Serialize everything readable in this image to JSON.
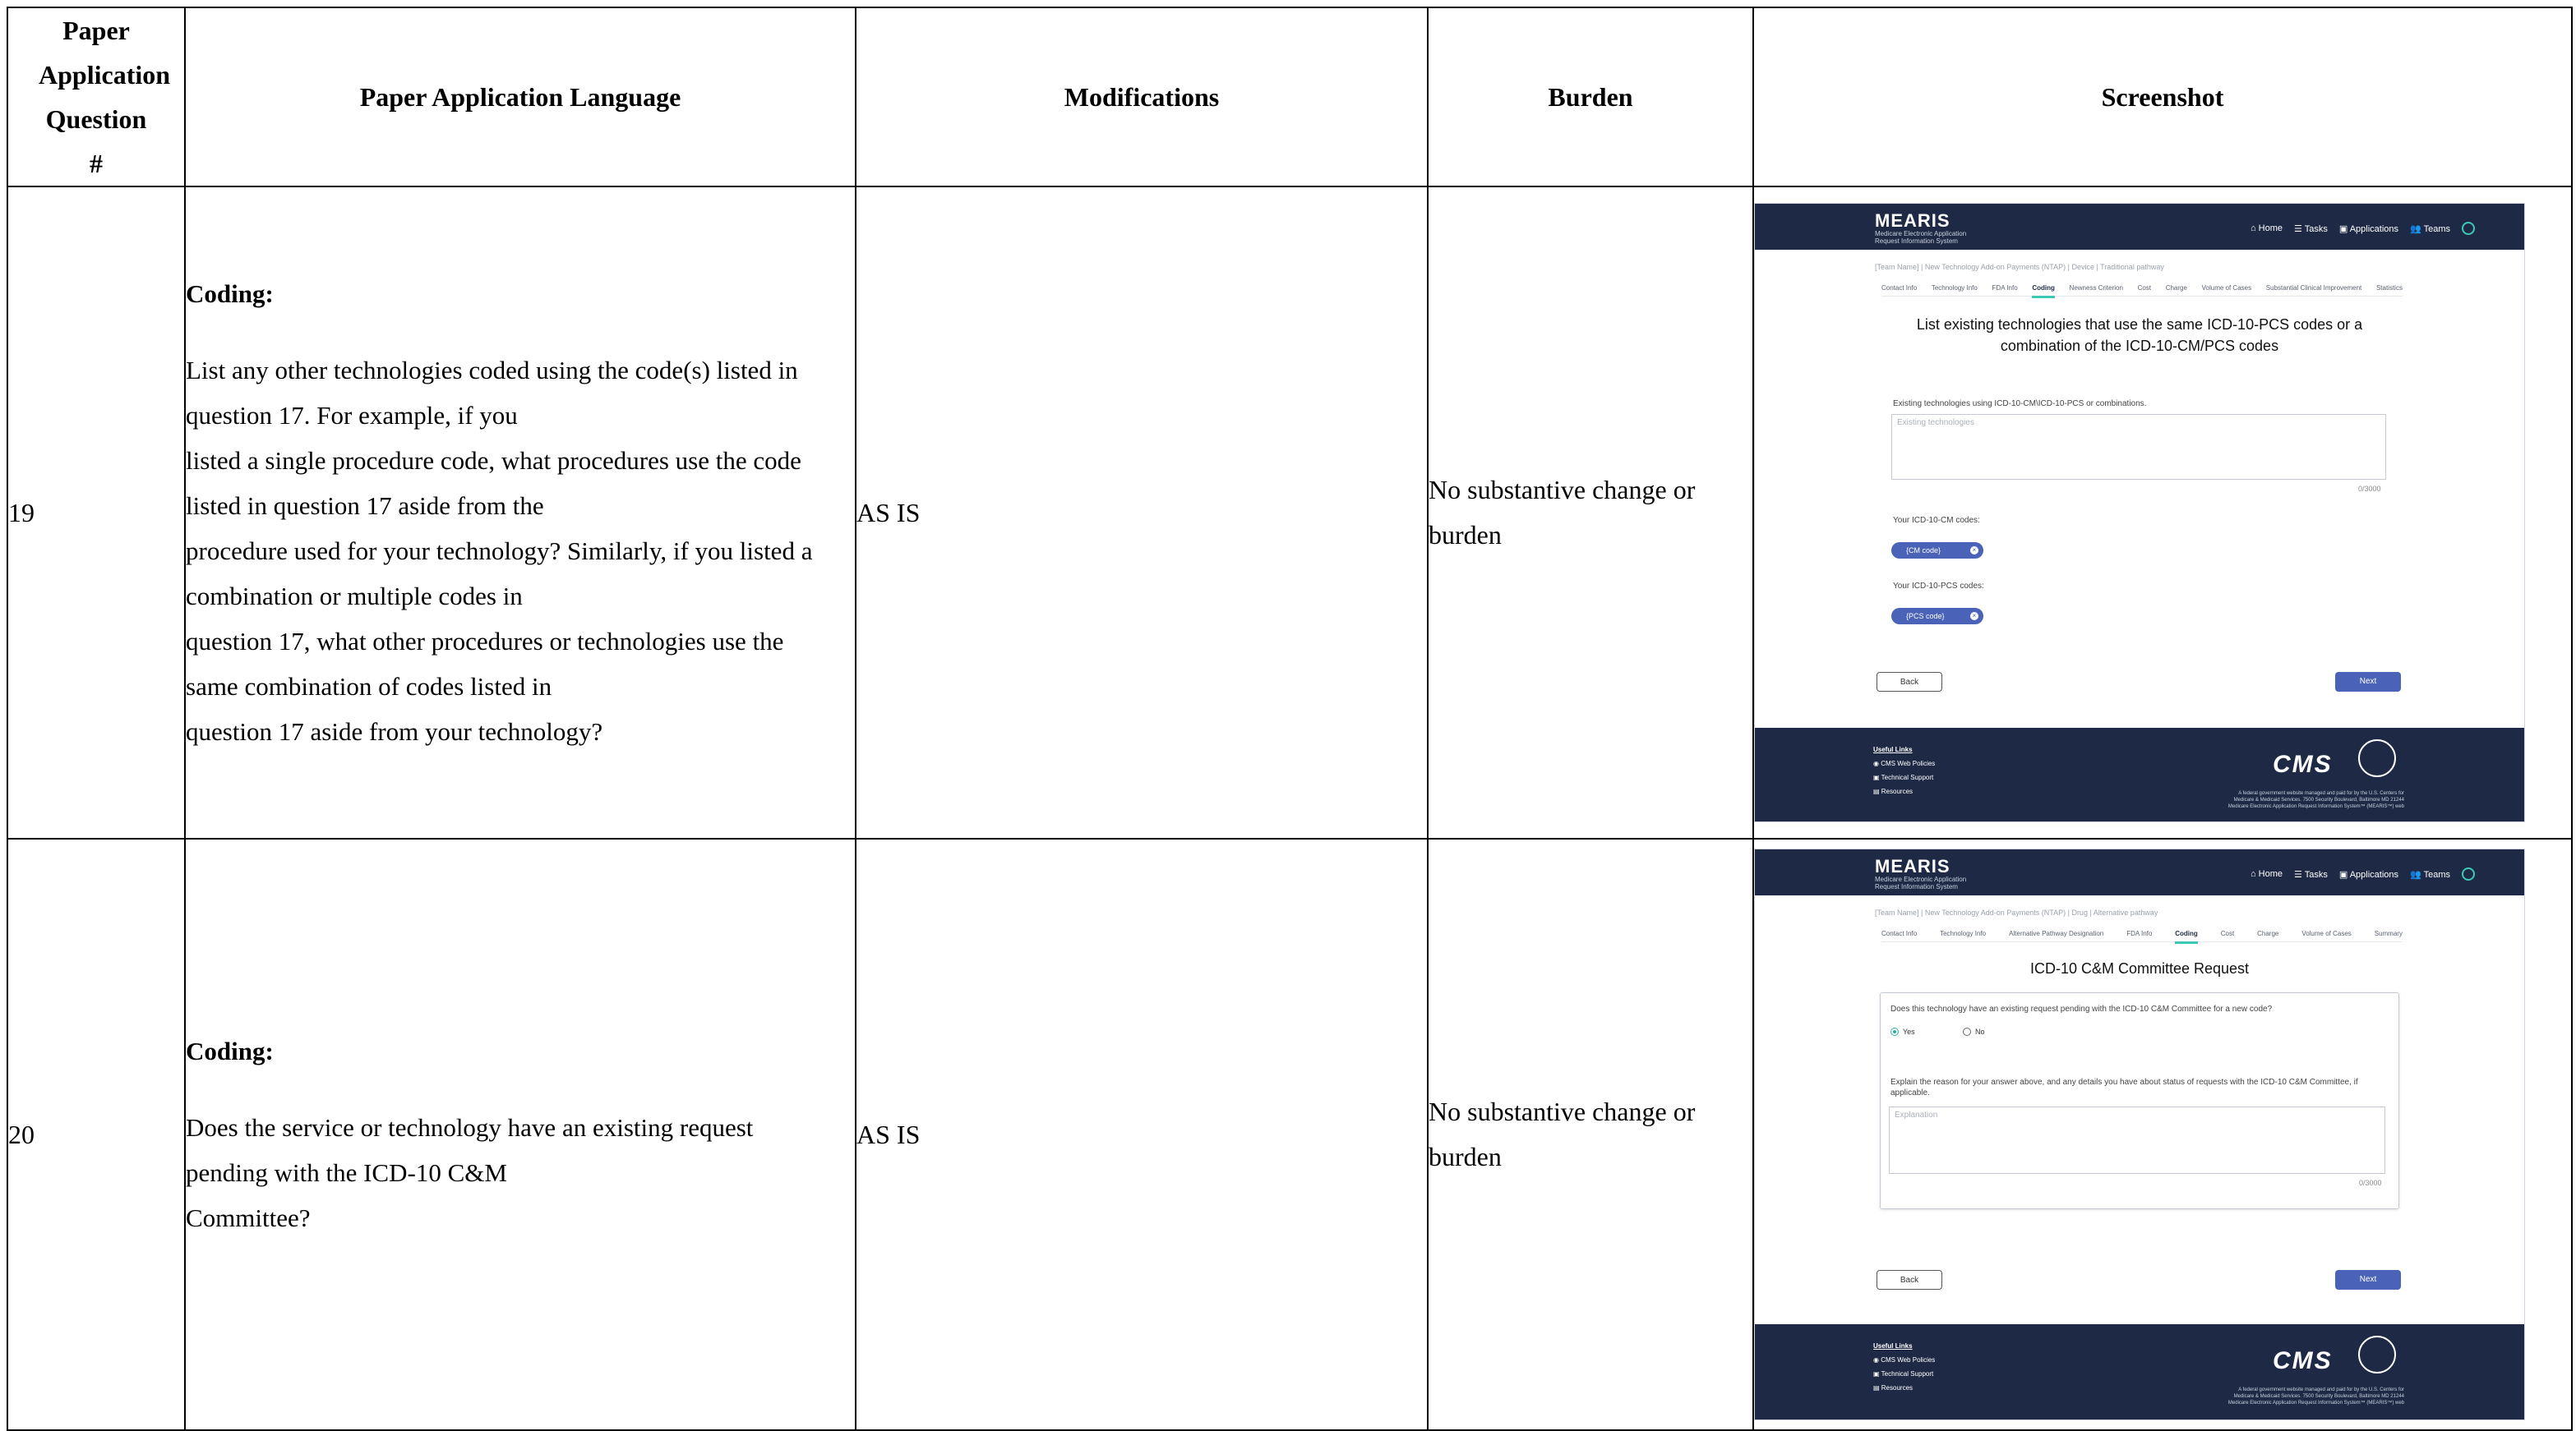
{
  "headers": {
    "question_num": "Paper Application Question #",
    "language": "Paper Application Language",
    "modifications": "Modifications",
    "burden": "Burden",
    "screenshot": "Screenshot"
  },
  "rows": [
    {
      "number": "19",
      "lang_head": "Coding:",
      "lang_lines": [
        "List any other technologies coded using the code(s) listed in",
        "question 17. For example, if you",
        "listed a single procedure code, what procedures use the code",
        "listed in question 17 aside from the",
        "procedure used for your technology? Similarly, if you listed a",
        "combination or multiple codes in",
        "question 17, what other procedures or technologies use the",
        "same combination of codes listed in",
        "question 17 aside from your technology?"
      ],
      "modifications": "AS IS",
      "burden_lines": [
        "No substantive change or",
        "burden"
      ],
      "shot": {
        "logo": "MEARIS",
        "logo_sub": "Medicare Electronic Application Request Information System",
        "nav": [
          "Home",
          "Tasks",
          "Applications",
          "Teams"
        ],
        "breadcrumb": "[Team Name] | New Technology Add-on Payments (NTAP) | Device | Traditional pathway",
        "tabs": [
          "Contact Info",
          "Technology Info",
          "FDA Info",
          "Coding",
          "Newness Criterion",
          "Cost",
          "Charge",
          "Volume of Cases",
          "Substantial Clinical Improvement",
          "Statistics"
        ],
        "active_tab": "Coding",
        "title_lines": [
          "List existing technologies that use the same ICD-10-PCS codes or a",
          "combination of the ICD-10-CM/PCS codes"
        ],
        "field_label": "Existing technologies using ICD-10-CM\\ICD-10-PCS or combinations.",
        "field_placeholder": "Existing technologies",
        "counter": "0/3000",
        "cm_label": "Your ICD-10-CM codes:",
        "cm_chip": "{CM code}",
        "pcs_label": "Your ICD-10-PCS codes:",
        "pcs_chip": "{PCS code}",
        "back": "Back",
        "next": "Next",
        "footer_heading": "Useful Links",
        "footer_links": [
          "CMS Web Policies",
          "Technical Support",
          "Resources"
        ],
        "cms": "CMS",
        "footer_note": "A federal government website managed and paid for by the U.S. Centers for Medicare & Medicaid Services. 7500 Security Boulevard, Baltimore MD 21244 Medicare Electronic Application Request Information System™ (MEARIS™) web"
      }
    },
    {
      "number": "20",
      "lang_head": "Coding:",
      "lang_lines": [
        "Does the service or technology have an existing request",
        "pending with the ICD-10 C&M",
        "Committee?"
      ],
      "modifications": "AS IS",
      "burden_lines": [
        "No substantive change or",
        "burden"
      ],
      "shot": {
        "logo": "MEARIS",
        "logo_sub": "Medicare Electronic Application Request Information System",
        "nav": [
          "Home",
          "Tasks",
          "Applications",
          "Teams"
        ],
        "breadcrumb": "[Team Name] | New Technology Add-on Payments (NTAP) | Drug | Alternative pathway",
        "tabs": [
          "Contact Info",
          "Technology Info",
          "Alternative Pathway Designation",
          "FDA Info",
          "Coding",
          "Cost",
          "Charge",
          "Volume of Cases",
          "Summary"
        ],
        "active_tab": "Coding",
        "title": "ICD-10 C&M Committee Request",
        "question": "Does this technology have an existing request pending with the ICD-10 C&M Committee for a new code?",
        "yes": "Yes",
        "no": "No",
        "explain": "Explain the reason for your answer above, and any details you have about status of requests with the ICD-10 C&M Committee, if applicable.",
        "field_placeholder": "Explanation",
        "counter": "0/3000",
        "back": "Back",
        "next": "Next",
        "footer_heading": "Useful Links",
        "footer_links": [
          "CMS Web Policies",
          "Technical Support",
          "Resources"
        ],
        "cms": "CMS",
        "footer_note": "A federal government website managed and paid for by the U.S. Centers for Medicare & Medicaid Services. 7500 Security Boulevard, Baltimore MD 21244 Medicare Electronic Application Request Information System™ (MEARIS™) web"
      }
    }
  ]
}
